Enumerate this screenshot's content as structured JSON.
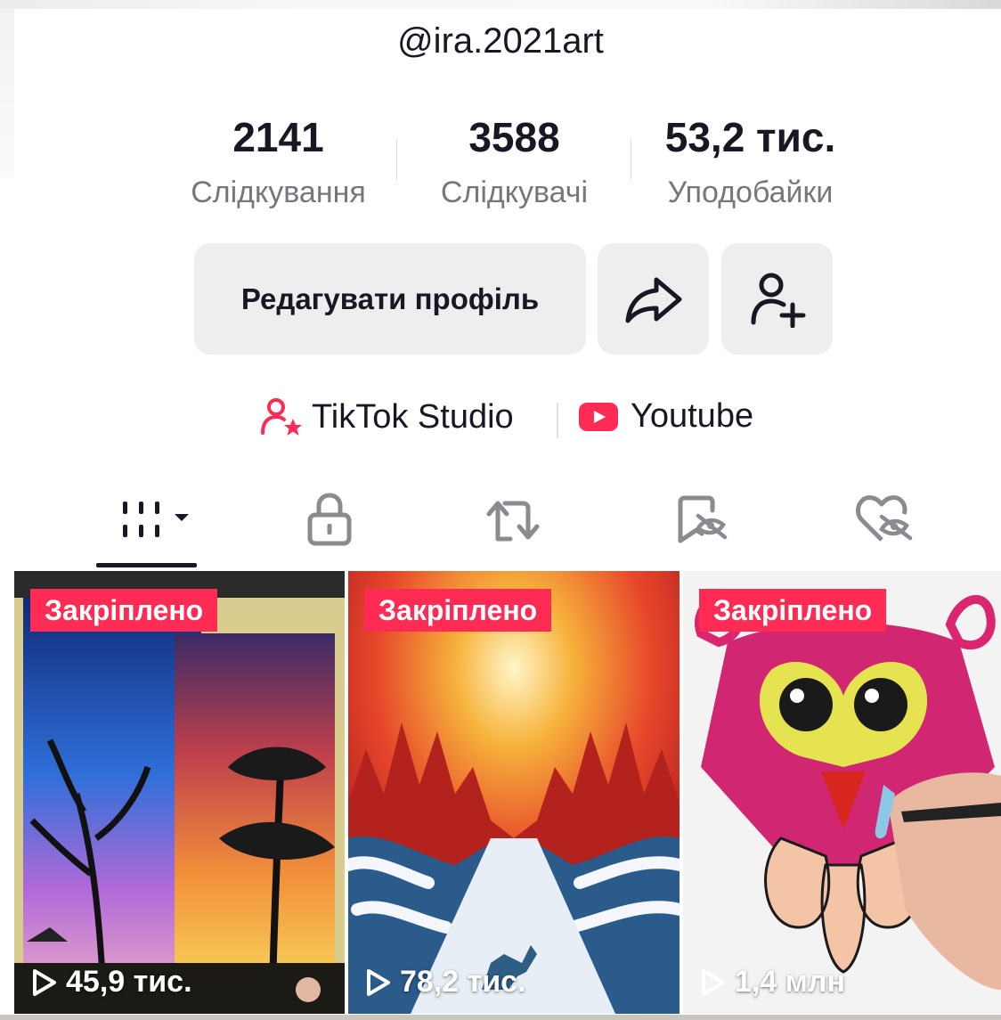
{
  "profile": {
    "username": "@ira.2021art"
  },
  "stats": [
    {
      "value": "2141",
      "label": "Слідкування"
    },
    {
      "value": "3588",
      "label": "Слідкувачі"
    },
    {
      "value": "53,2 тис.",
      "label": "Уподобайки"
    }
  ],
  "actions": {
    "edit_label": "Редагувати профіль",
    "share_icon": "share-arrow-icon",
    "add_friend_icon": "add-user-icon"
  },
  "links": [
    {
      "label": "TikTok Studio",
      "icon": "creator-star-icon"
    },
    {
      "label": "Youtube",
      "icon": "youtube-icon"
    }
  ],
  "tabs": [
    {
      "icon": "grid-videos-icon",
      "selected": true
    },
    {
      "icon": "lock-icon"
    },
    {
      "icon": "repost-icon"
    },
    {
      "icon": "favorites-hidden-icon"
    },
    {
      "icon": "liked-hidden-icon"
    }
  ],
  "videos": [
    {
      "badge": "Закріплено",
      "views": "45,9 тис."
    },
    {
      "badge": "Закріплено",
      "views": "78,2 тис."
    },
    {
      "badge": "Закріплено",
      "views": "1,4 млн"
    }
  ],
  "colors": {
    "accent": "#fe2c55",
    "text": "#161823",
    "muted": "#75777d",
    "button_bg": "#eeeeee"
  }
}
